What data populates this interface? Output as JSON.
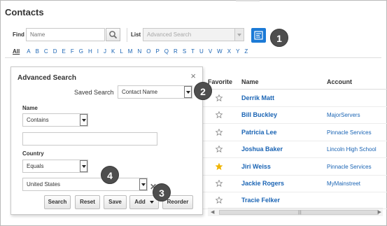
{
  "page": {
    "title": "Contacts"
  },
  "search": {
    "find_label": "Find",
    "find_placeholder": "Name",
    "list_label": "List",
    "list_value": "Advanced Search"
  },
  "alphabet": [
    "All",
    "A",
    "B",
    "C",
    "D",
    "E",
    "F",
    "G",
    "H",
    "I",
    "J",
    "K",
    "L",
    "M",
    "N",
    "O",
    "P",
    "Q",
    "R",
    "S",
    "T",
    "U",
    "V",
    "W",
    "X",
    "Y",
    "Z"
  ],
  "callouts": [
    "1",
    "2",
    "3",
    "4"
  ],
  "advanced_search": {
    "title": "Advanced Search",
    "close_icon": "close-icon",
    "saved_search_label": "Saved Search",
    "saved_search_value": "Contact Name",
    "name_label": "Name",
    "name_operator": "Contains",
    "name_value": "",
    "country_label": "Country",
    "country_operator": "Equals",
    "country_value": "United States",
    "buttons": {
      "search": "Search",
      "reset": "Reset",
      "save": "Save",
      "add": "Add",
      "reorder": "Reorder"
    }
  },
  "grid": {
    "columns": [
      "Favorite",
      "Name",
      "Account"
    ],
    "rows": [
      {
        "favorite": false,
        "name": "Derrik Matt",
        "account": ""
      },
      {
        "favorite": false,
        "name": "Bill Buckley",
        "account": "MajorServers"
      },
      {
        "favorite": false,
        "name": "Patricia Lee",
        "account": "Pinnacle Services"
      },
      {
        "favorite": false,
        "name": "Joshua Baker",
        "account": "Lincoln High School"
      },
      {
        "favorite": true,
        "name": "Jiri Weiss",
        "account": "Pinnacle Services"
      },
      {
        "favorite": false,
        "name": "Jackie Rogers",
        "account": "MyMainstreet"
      },
      {
        "favorite": false,
        "name": "Tracie Felker",
        "account": ""
      }
    ]
  },
  "colors": {
    "accent": "#1c7ad6",
    "link": "#1a64b4",
    "favorite_star": "#f0b400",
    "callout": "#4e4e4e"
  }
}
